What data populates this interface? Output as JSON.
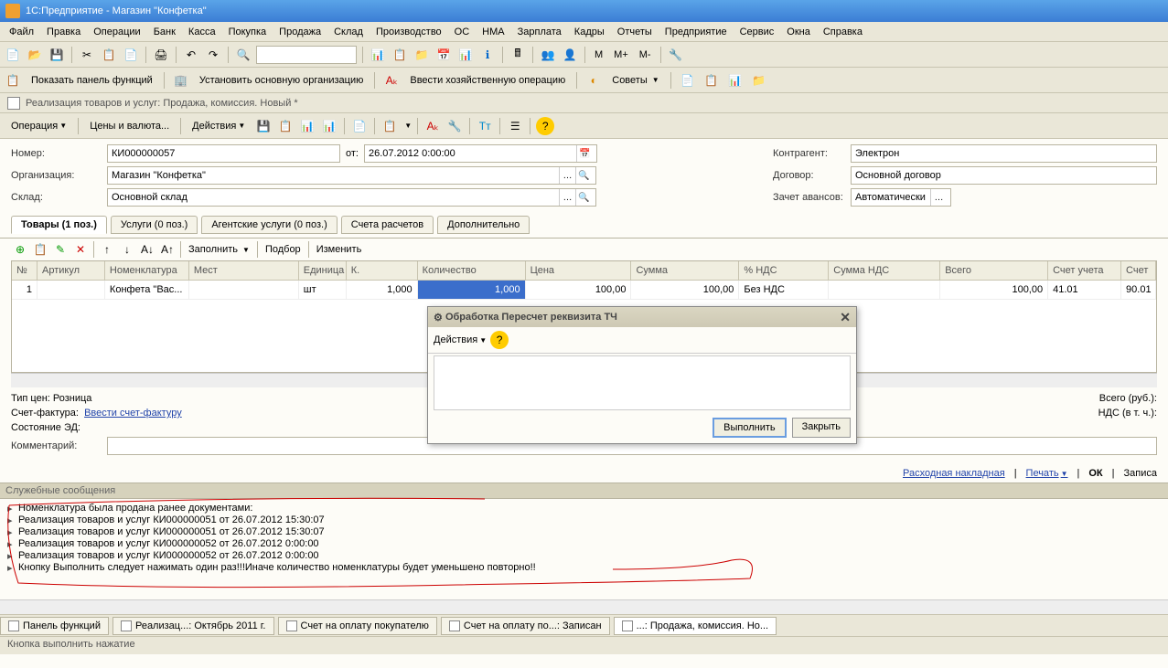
{
  "titlebar": "1С:Предприятие - Магазин \"Конфетка\"",
  "menubar": [
    "Файл",
    "Правка",
    "Операции",
    "Банк",
    "Касса",
    "Покупка",
    "Продажа",
    "Склад",
    "Производство",
    "ОС",
    "НМА",
    "Зарплата",
    "Кадры",
    "Отчеты",
    "Предприятие",
    "Сервис",
    "Окна",
    "Справка"
  ],
  "toolbar2": {
    "show_panel": "Показать панель функций",
    "set_org": "Установить основную организацию",
    "enter_op": "Ввести хозяйственную операцию",
    "advice": "Советы",
    "m": "М",
    "mplus": "М+",
    "mminus": "М-"
  },
  "doc_header": "Реализация товаров и услуг: Продажа, комиссия. Новый *",
  "doc_toolbar": {
    "operation": "Операция",
    "prices": "Цены и валюта...",
    "actions": "Действия"
  },
  "form": {
    "number_label": "Номер:",
    "number": "КИ000000057",
    "from_label": "от:",
    "date": "26.07.2012 0:00:00",
    "org_label": "Организация:",
    "org": "Магазин \"Конфетка\"",
    "warehouse_label": "Склад:",
    "warehouse": "Основной склад",
    "contr_label": "Контрагент:",
    "contr": "Электрон",
    "contract_label": "Договор:",
    "contract": "Основной договор",
    "advance_label": "Зачет авансов:",
    "advance": "Автоматически"
  },
  "tabs": [
    "Товары (1 поз.)",
    "Услуги (0 поз.)",
    "Агентские услуги (0 поз.)",
    "Счета расчетов",
    "Дополнительно"
  ],
  "grid_buttons": {
    "fill": "Заполнить",
    "pick": "Подбор",
    "edit": "Изменить"
  },
  "grid": {
    "cols": [
      "№",
      "Артикул",
      "Номенклатура",
      "Мест",
      "Единица",
      "К.",
      "Количество",
      "Цена",
      "Сумма",
      "% НДС",
      "Сумма НДС",
      "Всего",
      "Счет учета",
      "Счет"
    ],
    "widths": [
      28,
      74,
      92,
      120,
      52,
      78,
      118,
      116,
      118,
      98,
      122,
      118,
      80,
      38
    ],
    "row": [
      "1",
      "",
      "Конфета \"Вас...",
      "",
      "шт",
      "1,000",
      "1,000",
      "100,00",
      "100,00",
      "Без НДС",
      "",
      "100,00",
      "41.01",
      "90.01"
    ]
  },
  "modal": {
    "title": "Обработка  Пересчет реквизита ТЧ",
    "actions": "Действия",
    "execute": "Выполнить",
    "close": "Закрыть"
  },
  "info": {
    "price_label": "Тип цен: Розница",
    "invoice_label": "Счет-фактура:",
    "invoice_link": "Ввести счет-фактуру",
    "ed_label": "Состояние ЭД:",
    "comment_label": "Комментарий:",
    "total_label": "Всего (руб.):",
    "nds_label": "НДС (в т. ч.):"
  },
  "footer": {
    "rn": "Расходная накладная",
    "print": "Печать",
    "ok": "ОК",
    "save": "Записа"
  },
  "msg_header": "Служебные сообщения",
  "messages": [
    "Номенклатура была продана ранее документами:",
    "Реализация товаров и услуг КИ000000051 от 26.07.2012 15:30:07",
    "Реализация товаров и услуг КИ000000051 от 26.07.2012 15:30:07",
    "Реализация товаров и услуг КИ000000052 от 26.07.2012 0:00:00",
    "Реализация товаров и услуг КИ000000052 от 26.07.2012 0:00:00",
    "Кнопку Выполнить следует нажимать один раз!!!Иначе количество номенклатуры будет уменьшено повторно!!"
  ],
  "taskbar": [
    "Панель функций",
    "Реализац...: Октябрь 2011 г.",
    "Счет на оплату покупателю",
    "Счет на оплату по...: Записан",
    "...: Продажа, комиссия. Но..."
  ],
  "status": "Кнопка выполнить нажатие"
}
